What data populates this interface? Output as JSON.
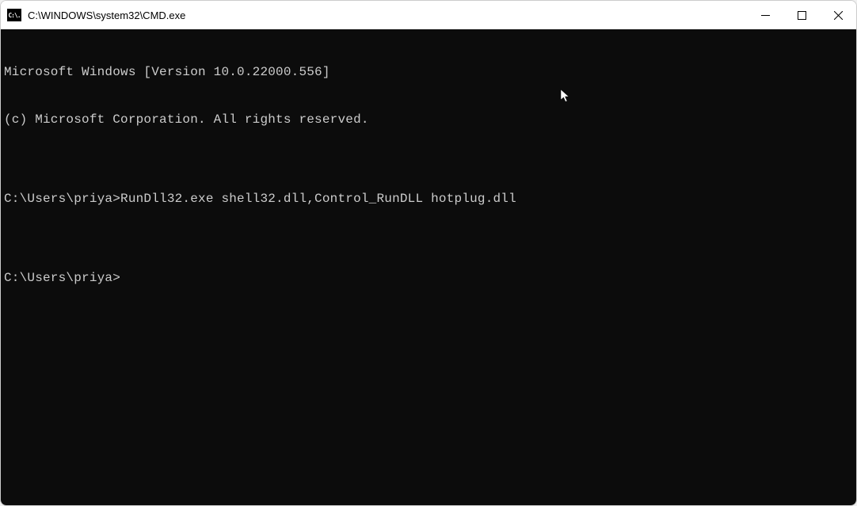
{
  "window": {
    "title": "C:\\WINDOWS\\system32\\CMD.exe",
    "icon_label": "C:\\."
  },
  "terminal": {
    "lines": [
      "Microsoft Windows [Version 10.0.22000.556]",
      "(c) Microsoft Corporation. All rights reserved.",
      "",
      "C:\\Users\\priya>RunDll32.exe shell32.dll,Control_RunDLL hotplug.dll",
      "",
      "C:\\Users\\priya>"
    ]
  }
}
